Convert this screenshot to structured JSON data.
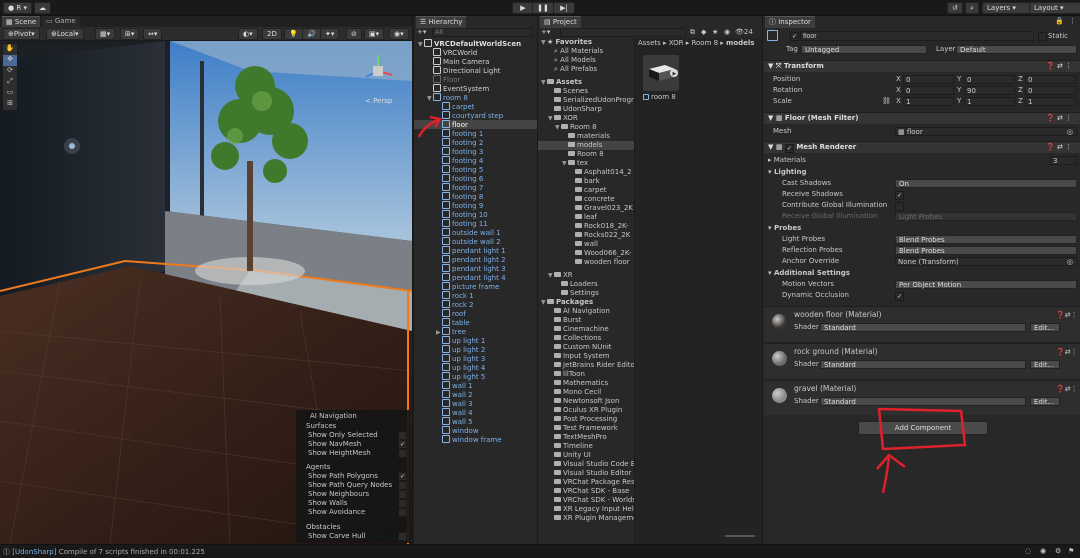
{
  "toolbar": {
    "account": "R",
    "play_icon": "play-icon",
    "pause_icon": "pause-icon",
    "step_icon": "step-icon",
    "layers": "Layers",
    "layout": "Layout"
  },
  "scene": {
    "tabs": [
      "Scene",
      "Game"
    ],
    "pivot": "Pivot",
    "local": "Local",
    "mode_2d": "2D",
    "persp": "< Persp",
    "nav_overlay": {
      "title": "AI Navigation",
      "surfaces": "Surfaces",
      "surface_items": [
        {
          "label": "Show Only Selected",
          "checked": false
        },
        {
          "label": "Show NavMesh",
          "checked": true
        },
        {
          "label": "Show HeightMesh",
          "checked": false
        }
      ],
      "agents": "Agents",
      "agent_items": [
        {
          "label": "Show Path Polygons",
          "checked": true
        },
        {
          "label": "Show Path Query Nodes",
          "checked": false
        },
        {
          "label": "Show Neighbours",
          "checked": false
        },
        {
          "label": "Show Walls",
          "checked": false
        },
        {
          "label": "Show Avoidance",
          "checked": false
        }
      ],
      "obstacles": "Obstacles",
      "obstacle_items": [
        {
          "label": "Show Carve Hull",
          "checked": false
        }
      ]
    }
  },
  "hierarchy": {
    "tab": "Hierarchy",
    "search_placeholder": "All",
    "root": "VRCDefaultWorldScen",
    "items": [
      {
        "label": "VRCWorld",
        "indent": 1,
        "style": "w"
      },
      {
        "label": "Main Camera",
        "indent": 1,
        "style": "w"
      },
      {
        "label": "Directional Light",
        "indent": 1,
        "style": "w"
      },
      {
        "label": "Floor",
        "indent": 1,
        "style": "grey"
      },
      {
        "label": "EventSystem",
        "indent": 1,
        "style": "w"
      },
      {
        "label": "room 8",
        "indent": 1,
        "style": "blue",
        "expand": true
      },
      {
        "label": "carpet",
        "indent": 2,
        "style": "blue"
      },
      {
        "label": "courtyard step",
        "indent": 2,
        "style": "blue"
      },
      {
        "label": "floor",
        "indent": 2,
        "style": "sel"
      },
      {
        "label": "footing 1",
        "indent": 2,
        "style": "blue"
      },
      {
        "label": "footing 2",
        "indent": 2,
        "style": "blue"
      },
      {
        "label": "footing 3",
        "indent": 2,
        "style": "blue"
      },
      {
        "label": "footing 4",
        "indent": 2,
        "style": "blue"
      },
      {
        "label": "footing 5",
        "indent": 2,
        "style": "blue"
      },
      {
        "label": "footing 6",
        "indent": 2,
        "style": "blue"
      },
      {
        "label": "footing 7",
        "indent": 2,
        "style": "blue"
      },
      {
        "label": "footing 8",
        "indent": 2,
        "style": "blue"
      },
      {
        "label": "footing 9",
        "indent": 2,
        "style": "blue"
      },
      {
        "label": "footing 10",
        "indent": 2,
        "style": "blue"
      },
      {
        "label": "footing 11",
        "indent": 2,
        "style": "blue"
      },
      {
        "label": "outside wall 1",
        "indent": 2,
        "style": "blue"
      },
      {
        "label": "outside wall 2",
        "indent": 2,
        "style": "blue"
      },
      {
        "label": "pendant light 1",
        "indent": 2,
        "style": "blue"
      },
      {
        "label": "pendant light 2",
        "indent": 2,
        "style": "blue"
      },
      {
        "label": "pendant light 3",
        "indent": 2,
        "style": "blue"
      },
      {
        "label": "pendant light 4",
        "indent": 2,
        "style": "blue"
      },
      {
        "label": "picture frame",
        "indent": 2,
        "style": "blue"
      },
      {
        "label": "rock 1",
        "indent": 2,
        "style": "blue"
      },
      {
        "label": "rock 2",
        "indent": 2,
        "style": "blue"
      },
      {
        "label": "roof",
        "indent": 2,
        "style": "blue"
      },
      {
        "label": "table",
        "indent": 2,
        "style": "blue"
      },
      {
        "label": "tree",
        "indent": 2,
        "style": "blue",
        "collapsed": true
      },
      {
        "label": "up light 1",
        "indent": 2,
        "style": "blue"
      },
      {
        "label": "up light 2",
        "indent": 2,
        "style": "blue"
      },
      {
        "label": "up light 3",
        "indent": 2,
        "style": "blue"
      },
      {
        "label": "up light 4",
        "indent": 2,
        "style": "blue"
      },
      {
        "label": "up light 5",
        "indent": 2,
        "style": "blue"
      },
      {
        "label": "wall 1",
        "indent": 2,
        "style": "blue"
      },
      {
        "label": "wall 2",
        "indent": 2,
        "style": "blue"
      },
      {
        "label": "wall 3",
        "indent": 2,
        "style": "blue"
      },
      {
        "label": "wall 4",
        "indent": 2,
        "style": "blue"
      },
      {
        "label": "wall 5",
        "indent": 2,
        "style": "blue"
      },
      {
        "label": "window",
        "indent": 2,
        "style": "blue"
      },
      {
        "label": "window frame",
        "indent": 2,
        "style": "blue"
      }
    ]
  },
  "project": {
    "tab": "Project",
    "count": "24",
    "breadcrumb": [
      "Assets",
      "XOR",
      "Room 8",
      "models"
    ],
    "asset_label": "room 8",
    "tree": [
      {
        "label": "Favorites",
        "indent": 0,
        "bold": true,
        "type": "star"
      },
      {
        "label": "All Materials",
        "indent": 1,
        "type": "search"
      },
      {
        "label": "All Models",
        "indent": 1,
        "type": "search"
      },
      {
        "label": "All Prefabs",
        "indent": 1,
        "type": "search"
      },
      {
        "label": "",
        "indent": 0,
        "type": "spacer"
      },
      {
        "label": "Assets",
        "indent": 0,
        "bold": true,
        "type": "folder"
      },
      {
        "label": "Scenes",
        "indent": 1,
        "type": "folder"
      },
      {
        "label": "SerializedUdonProgra",
        "indent": 1,
        "type": "folder"
      },
      {
        "label": "UdonSharp",
        "indent": 1,
        "type": "folder"
      },
      {
        "label": "XOR",
        "indent": 1,
        "type": "folder"
      },
      {
        "label": "Room 8",
        "indent": 2,
        "type": "folder"
      },
      {
        "label": "materials",
        "indent": 3,
        "type": "folder"
      },
      {
        "label": "models",
        "indent": 3,
        "type": "folder",
        "selected": true
      },
      {
        "label": "Room 8",
        "indent": 3,
        "type": "folder"
      },
      {
        "label": "tex",
        "indent": 3,
        "type": "folder"
      },
      {
        "label": "Asphalt014_2",
        "indent": 4,
        "type": "folder"
      },
      {
        "label": "bark",
        "indent": 4,
        "type": "folder"
      },
      {
        "label": "carpet",
        "indent": 4,
        "type": "folder"
      },
      {
        "label": "concrete",
        "indent": 4,
        "type": "folder"
      },
      {
        "label": "Gravel023_2K",
        "indent": 4,
        "type": "folder"
      },
      {
        "label": "leaf",
        "indent": 4,
        "type": "folder"
      },
      {
        "label": "Rock018_2K-",
        "indent": 4,
        "type": "folder"
      },
      {
        "label": "Rocks022_2K",
        "indent": 4,
        "type": "folder"
      },
      {
        "label": "wall",
        "indent": 4,
        "type": "folder"
      },
      {
        "label": "Wood066_2K-",
        "indent": 4,
        "type": "folder"
      },
      {
        "label": "wooden floor",
        "indent": 4,
        "type": "folder"
      },
      {
        "label": "",
        "indent": 0,
        "type": "spacer"
      },
      {
        "label": "XR",
        "indent": 1,
        "type": "folder"
      },
      {
        "label": "Loaders",
        "indent": 2,
        "type": "folder"
      },
      {
        "label": "Settings",
        "indent": 2,
        "type": "folder"
      },
      {
        "label": "Packages",
        "indent": 0,
        "bold": true,
        "type": "folder"
      },
      {
        "label": "AI Navigation",
        "indent": 1,
        "type": "folder"
      },
      {
        "label": "Burst",
        "indent": 1,
        "type": "folder"
      },
      {
        "label": "Cinemachine",
        "indent": 1,
        "type": "folder"
      },
      {
        "label": "Collections",
        "indent": 1,
        "type": "folder"
      },
      {
        "label": "Custom NUnit",
        "indent": 1,
        "type": "folder"
      },
      {
        "label": "Input System",
        "indent": 1,
        "type": "folder"
      },
      {
        "label": "JetBrains Rider Editor",
        "indent": 1,
        "type": "folder"
      },
      {
        "label": "lilToon",
        "indent": 1,
        "type": "folder"
      },
      {
        "label": "Mathematics",
        "indent": 1,
        "type": "folder"
      },
      {
        "label": "Mono Cecil",
        "indent": 1,
        "type": "folder"
      },
      {
        "label": "Newtonsoft Json",
        "indent": 1,
        "type": "folder"
      },
      {
        "label": "Oculus XR Plugin",
        "indent": 1,
        "type": "folder"
      },
      {
        "label": "Post Processing",
        "indent": 1,
        "type": "folder"
      },
      {
        "label": "Test Framework",
        "indent": 1,
        "type": "folder"
      },
      {
        "label": "TextMeshPro",
        "indent": 1,
        "type": "folder"
      },
      {
        "label": "Timeline",
        "indent": 1,
        "type": "folder"
      },
      {
        "label": "Unity UI",
        "indent": 1,
        "type": "folder"
      },
      {
        "label": "Visual Studio Code Ed",
        "indent": 1,
        "type": "folder"
      },
      {
        "label": "Visual Studio Editor",
        "indent": 1,
        "type": "folder"
      },
      {
        "label": "VRChat Package Reso",
        "indent": 1,
        "type": "folder"
      },
      {
        "label": "VRChat SDK - Base",
        "indent": 1,
        "type": "folder"
      },
      {
        "label": "VRChat SDK - Worlds",
        "indent": 1,
        "type": "folder"
      },
      {
        "label": "XR Legacy Input Help",
        "indent": 1,
        "type": "folder"
      },
      {
        "label": "XR Plugin Manageme",
        "indent": 1,
        "type": "folder"
      }
    ]
  },
  "inspector": {
    "tab": "Inspector",
    "object_name": "floor",
    "static": "Static",
    "tag_label": "Tag",
    "tag_value": "Untagged",
    "layer_label": "Layer",
    "layer_value": "Default",
    "transform": {
      "title": "Transform",
      "rows": [
        {
          "label": "Position",
          "x": "0",
          "y": "0",
          "z": "0"
        },
        {
          "label": "Rotation",
          "x": "0",
          "y": "90",
          "z": "0"
        },
        {
          "label": "Scale",
          "x": "1",
          "y": "1",
          "z": "1"
        }
      ]
    },
    "mesh_filter": {
      "title": "Floor (Mesh Filter)",
      "mesh_label": "Mesh",
      "mesh_value": "floor"
    },
    "mesh_renderer": {
      "title": "Mesh Renderer",
      "materials_label": "Materials",
      "materials_count": "3",
      "lighting": "Lighting",
      "cast_shadows_label": "Cast Shadows",
      "cast_shadows_value": "On",
      "receive_shadows_label": "Receive Shadows",
      "contribute_gi_label": "Contribute Global Illumination",
      "receive_gi_label": "Receive Global Illumination",
      "receive_gi_value": "Light Probes",
      "probes": "Probes",
      "light_probes_label": "Light Probes",
      "light_probes_value": "Blend Probes",
      "reflection_probes_label": "Reflection Probes",
      "reflection_probes_value": "Blend Probes",
      "anchor_override_label": "Anchor Override",
      "anchor_override_value": "None (Transform)",
      "additional": "Additional Settings",
      "motion_vectors_label": "Motion Vectors",
      "motion_vectors_value": "Per Object Motion",
      "dynamic_occlusion_label": "Dynamic Occlusion"
    },
    "materials": [
      {
        "name": "wooden floor (Material)",
        "shader_label": "Shader",
        "shader": "Standard",
        "edit": "Edit...",
        "swatch": "#3a3532"
      },
      {
        "name": "rock ground (Material)",
        "shader_label": "Shader",
        "shader": "Standard",
        "edit": "Edit...",
        "swatch": "#6b6a68"
      },
      {
        "name": "gravel (Material)",
        "shader_label": "Shader",
        "shader": "Standard",
        "edit": "Edit...",
        "swatch": "#8a8884"
      }
    ],
    "add_component": "Add Component"
  },
  "status": {
    "tag": "UdonSharp",
    "message": "Compile of 7 scripts finished in 00:01.225"
  },
  "colors": {
    "annotation_red": "#e0202a",
    "selection_orange": "#f07a1a"
  }
}
